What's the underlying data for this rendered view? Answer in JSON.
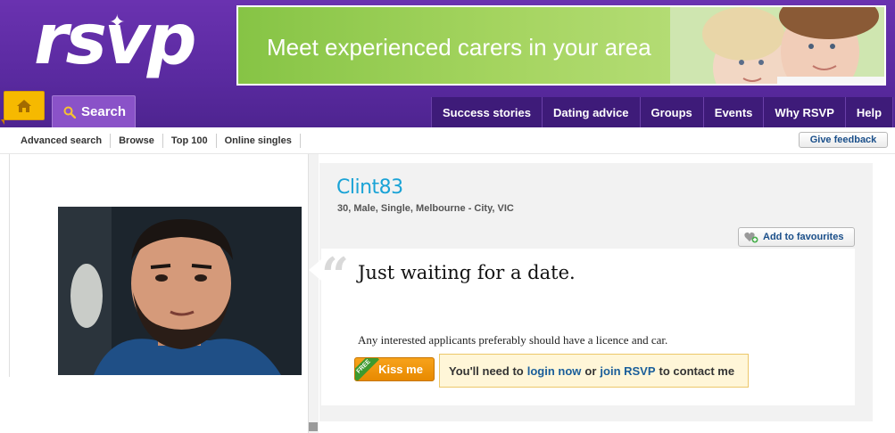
{
  "logo": {
    "text": "rsvp"
  },
  "banner": {
    "text": "Meet experienced carers in your area"
  },
  "nav": {
    "home_icon": "home-icon",
    "search_label": "Search",
    "items": [
      {
        "label": "Success stories"
      },
      {
        "label": "Dating advice"
      },
      {
        "label": "Groups"
      },
      {
        "label": "Events"
      },
      {
        "label": "Why RSVP"
      },
      {
        "label": "Help"
      }
    ]
  },
  "subnav": {
    "items": [
      {
        "label": "Advanced search"
      },
      {
        "label": "Browse"
      },
      {
        "label": "Top 100"
      },
      {
        "label": "Online singles"
      }
    ],
    "feedback_label": "Give feedback"
  },
  "profile": {
    "username": "Clint83",
    "details": "30, Male, Single, Melbourne - City, VIC",
    "favourites_label": "Add to favourites",
    "headline": "Just waiting for a date.",
    "about": "Any interested applicants preferably should have a licence and car.",
    "kiss_label": "Kiss me",
    "free_badge": "FREE",
    "contact": {
      "prefix": "You'll need to",
      "login_label": "login now",
      "middle": "or",
      "join_label": "join RSVP",
      "suffix": "to contact me"
    }
  },
  "colors": {
    "header_purple": "#5a2aa0",
    "nav_dark": "#3e1b79",
    "accent_orange": "#f6b900",
    "username_blue": "#1aa3d6",
    "link_blue": "#1a5e9a"
  }
}
